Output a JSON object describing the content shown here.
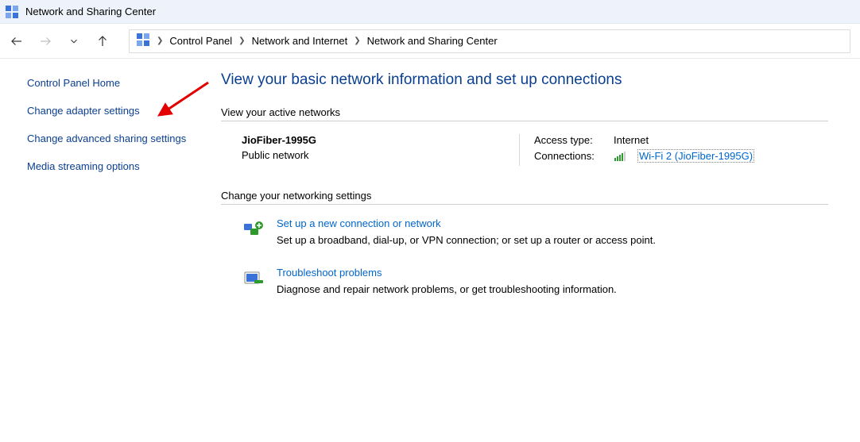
{
  "titlebar": {
    "text": "Network and Sharing Center"
  },
  "breadcrumb": {
    "items": [
      "Control Panel",
      "Network and Internet",
      "Network and Sharing Center"
    ]
  },
  "sidebar": {
    "items": [
      {
        "label": "Control Panel Home"
      },
      {
        "label": "Change adapter settings"
      },
      {
        "label": "Change advanced sharing settings"
      },
      {
        "label": "Media streaming options"
      }
    ]
  },
  "page": {
    "title": "View your basic network information and set up connections",
    "active_label": "View your active networks",
    "network": {
      "name": "JioFiber-1995G",
      "type": "Public network",
      "access_type_label": "Access type:",
      "access_type_value": "Internet",
      "connections_label": "Connections:",
      "connections_value": "Wi-Fi 2 (JioFiber-1995G)"
    },
    "change_label": "Change your networking settings",
    "options": [
      {
        "title": "Set up a new connection or network",
        "desc": "Set up a broadband, dial-up, or VPN connection; or set up a router or access point."
      },
      {
        "title": "Troubleshoot problems",
        "desc": "Diagnose and repair network problems, or get troubleshooting information."
      }
    ]
  }
}
